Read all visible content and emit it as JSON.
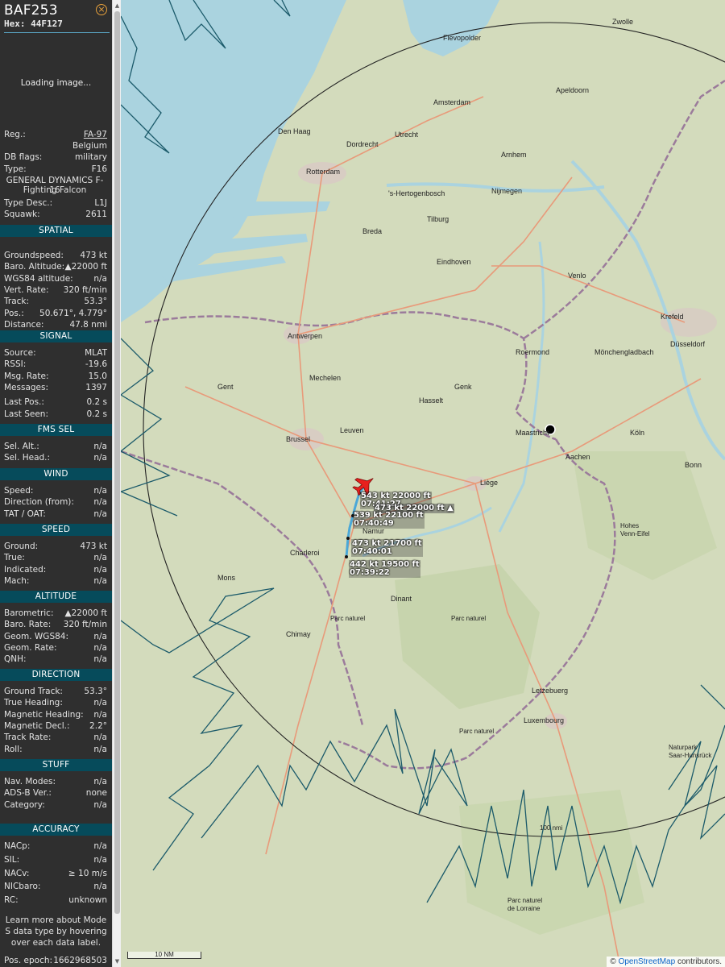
{
  "aircraft": {
    "callsign": "BAF253",
    "hex_label": "Hex:",
    "hex": "44F127",
    "loading_text": "Loading image...",
    "reg_label": "Reg.:",
    "reg": "FA-97",
    "country": "Belgium",
    "db_flags_label": "DB flags:",
    "db_flags": "military",
    "type_label": "Type:",
    "type": "F16",
    "type_name_line1": "GENERAL DYNAMICS F-16",
    "type_name_line2": "Fighting Falcon",
    "type_desc_label": "Type Desc.:",
    "type_desc": "L1J",
    "squawk_label": "Squawk:",
    "squawk": "2611"
  },
  "sections": {
    "spatial": "SPATIAL",
    "signal": "SIGNAL",
    "fms_sel": "FMS SEL",
    "wind": "WIND",
    "speed": "SPEED",
    "altitude": "ALTITUDE",
    "direction": "DIRECTION",
    "stuff": "STUFF",
    "accuracy": "ACCURACY"
  },
  "spatial": [
    {
      "label": "Groundspeed:",
      "value": "473 kt"
    },
    {
      "label": "Baro. Altitude:",
      "value": "▲22000 ft"
    },
    {
      "label": "WGS84 altitude:",
      "value": "n/a"
    },
    {
      "label": "Vert. Rate:",
      "value": "320 ft/min"
    },
    {
      "label": "Track:",
      "value": "53.3°"
    },
    {
      "label": "Pos.:",
      "value": "50.671°, 4.779°"
    },
    {
      "label": "Distance:",
      "value": "47.8 nmi"
    }
  ],
  "signal": [
    {
      "label": "Source:",
      "value": "MLAT"
    },
    {
      "label": "RSSI:",
      "value": "-19.6"
    },
    {
      "label": "Msg. Rate:",
      "value": "15.0"
    },
    {
      "label": "Messages:",
      "value": "1397"
    },
    {
      "label": "Last Pos.:",
      "value": "0.2 s"
    },
    {
      "label": "Last Seen:",
      "value": "0.2 s"
    }
  ],
  "fms_sel": [
    {
      "label": "Sel. Alt.:",
      "value": "n/a"
    },
    {
      "label": "Sel. Head.:",
      "value": "n/a"
    }
  ],
  "wind": [
    {
      "label": "Speed:",
      "value": "n/a"
    },
    {
      "label": "Direction (from):",
      "value": "n/a"
    },
    {
      "label": "TAT / OAT:",
      "value": "n/a"
    }
  ],
  "speed": [
    {
      "label": "Ground:",
      "value": "473 kt"
    },
    {
      "label": "True:",
      "value": "n/a"
    },
    {
      "label": "Indicated:",
      "value": "n/a"
    },
    {
      "label": "Mach:",
      "value": "n/a"
    }
  ],
  "altitude": [
    {
      "label": "Barometric:",
      "value": "▲22000 ft"
    },
    {
      "label": "Baro. Rate:",
      "value": "320 ft/min"
    },
    {
      "label": "Geom. WGS84:",
      "value": "n/a"
    },
    {
      "label": "Geom. Rate:",
      "value": "n/a"
    },
    {
      "label": "QNH:",
      "value": "n/a"
    }
  ],
  "direction": [
    {
      "label": "Ground Track:",
      "value": "53.3°"
    },
    {
      "label": "True Heading:",
      "value": "n/a"
    },
    {
      "label": "Magnetic Heading:",
      "value": "n/a"
    },
    {
      "label": "Magnetic Decl.:",
      "value": "2.2°"
    },
    {
      "label": "Track Rate:",
      "value": "n/a"
    },
    {
      "label": "Roll:",
      "value": "n/a"
    }
  ],
  "stuff": [
    {
      "label": "Nav. Modes:",
      "value": "n/a"
    },
    {
      "label": "ADS-B Ver.:",
      "value": "none"
    },
    {
      "label": "Category:",
      "value": "n/a"
    }
  ],
  "accuracy": [
    {
      "label": "NACp:",
      "value": "n/a"
    },
    {
      "label": "SIL:",
      "value": "n/a"
    },
    {
      "label": "NACv:",
      "value": "≥ 10 m/s"
    },
    {
      "label": "NICbaro:",
      "value": "n/a"
    },
    {
      "label": "RC:",
      "value": "unknown"
    }
  ],
  "learn_more": "Learn more about Mode S data type by hovering over each data label.",
  "pos_epoch_label": "Pos. epoch:",
  "pos_epoch": "1662968503",
  "map": {
    "range_ring_label": "100 nmi",
    "scale_label": "10 NM",
    "attribution_prefix": "©",
    "attribution_link": "OpenStreetMap",
    "attribution_suffix": "contributors.",
    "track_labels": [
      {
        "speed": "543 kt",
        "alt": "22000 ft",
        "time": "07:41:27"
      },
      {
        "speed": "539 kt",
        "alt": "22100 ft",
        "time": "07:40:49"
      },
      {
        "speed": "473 kt",
        "alt": "21700 ft",
        "time": "07:40:01"
      },
      {
        "speed": "442 kt",
        "alt": "19500 ft",
        "time": "07:39:22"
      }
    ],
    "hover_label": "473 kt  22000 ft ▲",
    "cities": [
      "Den Haag",
      "Rotterdam",
      "Amsterdam",
      "Utrecht",
      "Arnhem",
      "Nijmegen",
      "Breda",
      "Eindhoven",
      "Antwerpen",
      "Gent",
      "Brussel",
      "Leuven",
      "Mechelen",
      "Hasselt",
      "Liège",
      "Maastricht",
      "Aachen",
      "Namur",
      "Charleroi",
      "Köln",
      "Düsseldorf",
      "Mönchengladbach",
      "Krefeld",
      "Roermond",
      "Venlo",
      "'s-Hertogenbosch",
      "Tilburg",
      "Dordrecht",
      "Flevopolder",
      "Zwolle",
      "Apeldoorn",
      "Mons",
      "Luxembourg",
      "Letzebuerg",
      "Bonn",
      "Chimay",
      "Dinant",
      "Genk"
    ],
    "colors": {
      "water": "#aad3df",
      "land": "#d2d9bb",
      "track": "#4aa8d8",
      "plane": "#e8201e",
      "coverage": "#1b5a6a"
    }
  }
}
